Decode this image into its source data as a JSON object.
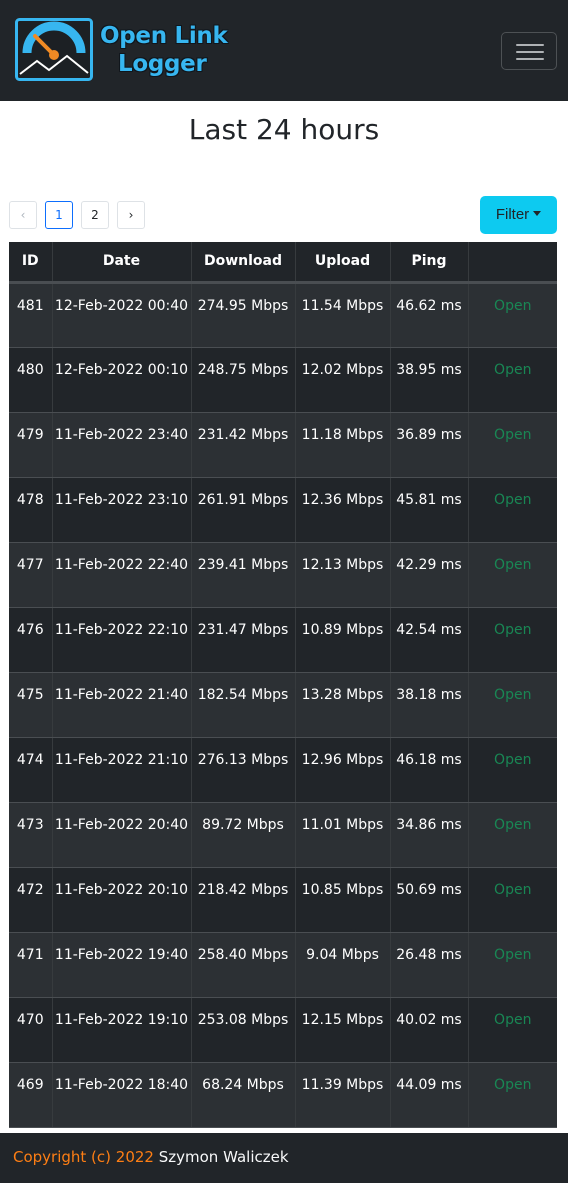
{
  "header": {
    "brand_line1": "Open Link",
    "brand_line2": "Logger",
    "menu_icon": "hamburger-icon",
    "brand_color": "#37b6f0"
  },
  "page": {
    "title": "Last 24 hours"
  },
  "pagination": {
    "prev": "‹",
    "pages": [
      "1",
      "2"
    ],
    "next": "›",
    "active_page": "1"
  },
  "filter": {
    "label": "Filter"
  },
  "table": {
    "columns": [
      "ID",
      "Date",
      "Download",
      "Upload",
      "Ping",
      ""
    ],
    "rows": [
      {
        "id": "481",
        "date": "12-Feb-2022 00:40",
        "download": "274.95 Mbps",
        "upload": "11.54 Mbps",
        "ping": "46.62 ms",
        "action": "Open"
      },
      {
        "id": "480",
        "date": "12-Feb-2022 00:10",
        "download": "248.75 Mbps",
        "upload": "12.02 Mbps",
        "ping": "38.95 ms",
        "action": "Open"
      },
      {
        "id": "479",
        "date": "11-Feb-2022 23:40",
        "download": "231.42 Mbps",
        "upload": "11.18 Mbps",
        "ping": "36.89 ms",
        "action": "Open"
      },
      {
        "id": "478",
        "date": "11-Feb-2022 23:10",
        "download": "261.91 Mbps",
        "upload": "12.36 Mbps",
        "ping": "45.81 ms",
        "action": "Open"
      },
      {
        "id": "477",
        "date": "11-Feb-2022 22:40",
        "download": "239.41 Mbps",
        "upload": "12.13 Mbps",
        "ping": "42.29 ms",
        "action": "Open"
      },
      {
        "id": "476",
        "date": "11-Feb-2022 22:10",
        "download": "231.47 Mbps",
        "upload": "10.89 Mbps",
        "ping": "42.54 ms",
        "action": "Open"
      },
      {
        "id": "475",
        "date": "11-Feb-2022 21:40",
        "download": "182.54 Mbps",
        "upload": "13.28 Mbps",
        "ping": "38.18 ms",
        "action": "Open"
      },
      {
        "id": "474",
        "date": "11-Feb-2022 21:10",
        "download": "276.13 Mbps",
        "upload": "12.96 Mbps",
        "ping": "46.18 ms",
        "action": "Open"
      },
      {
        "id": "473",
        "date": "11-Feb-2022 20:40",
        "download": "89.72 Mbps",
        "upload": "11.01 Mbps",
        "ping": "34.86 ms",
        "action": "Open"
      },
      {
        "id": "472",
        "date": "11-Feb-2022 20:10",
        "download": "218.42 Mbps",
        "upload": "10.85 Mbps",
        "ping": "50.69 ms",
        "action": "Open"
      },
      {
        "id": "471",
        "date": "11-Feb-2022 19:40",
        "download": "258.40 Mbps",
        "upload": "9.04 Mbps",
        "ping": "26.48 ms",
        "action": "Open"
      },
      {
        "id": "470",
        "date": "11-Feb-2022 19:10",
        "download": "253.08 Mbps",
        "upload": "12.15 Mbps",
        "ping": "40.02 ms",
        "action": "Open"
      },
      {
        "id": "469",
        "date": "11-Feb-2022 18:40",
        "download": "68.24 Mbps",
        "upload": "11.39 Mbps",
        "ping": "44.09 ms",
        "action": "Open"
      }
    ]
  },
  "footer": {
    "copyright": "Copyright (c) 2022",
    "author": "Szymon Waliczek"
  },
  "colors": {
    "navbar": "#212529",
    "filter_button": "#0dcaf0",
    "link": "#198754",
    "footer_copy": "#fd7e14"
  }
}
